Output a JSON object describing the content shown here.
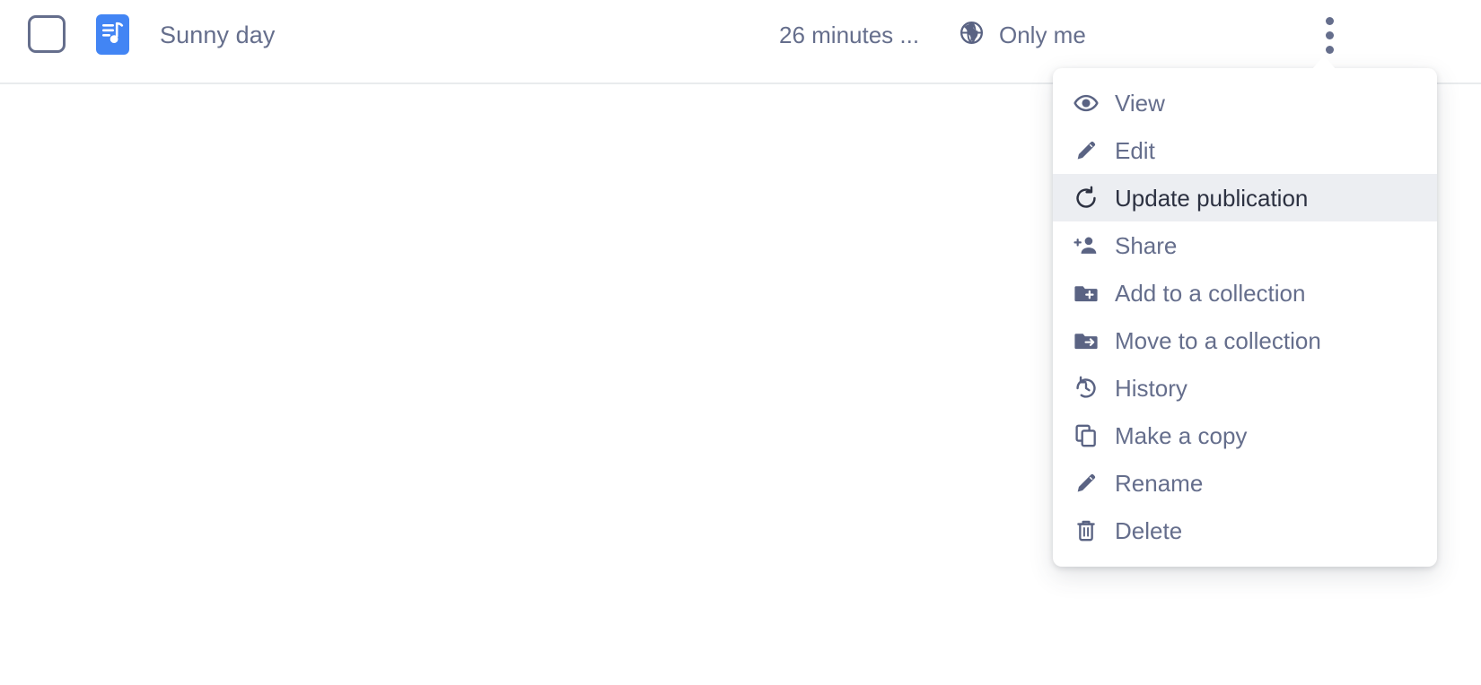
{
  "file_row": {
    "checkbox": {
      "name": "select-file-checkbox",
      "checked": false
    },
    "file_icon_name": "audio-file-icon",
    "title": "Sunny day",
    "modified_time": "26 minutes ...",
    "visibility": {
      "icon_name": "globe-icon",
      "label": "Only me"
    },
    "more_actions": {
      "icon_name": "kebab-menu-icon",
      "label": "More actions"
    }
  },
  "context_menu": {
    "items": [
      {
        "label": "View",
        "icon": "eye-icon",
        "active": false
      },
      {
        "label": "Edit",
        "icon": "pencil-icon",
        "active": false
      },
      {
        "label": "Update publication",
        "icon": "refresh-cw-icon",
        "active": true
      },
      {
        "label": "Share",
        "icon": "person-add-icon",
        "active": false
      },
      {
        "label": "Add to a collection",
        "icon": "folder-plus-icon",
        "active": false
      },
      {
        "label": "Move to a collection",
        "icon": "folder-arrow-icon",
        "active": false
      },
      {
        "label": "History",
        "icon": "history-clock-icon",
        "active": false
      },
      {
        "label": "Make a copy",
        "icon": "copy-icon",
        "active": false
      },
      {
        "label": "Rename",
        "icon": "pencil-icon",
        "active": false
      },
      {
        "label": "Delete",
        "icon": "trash-icon",
        "active": false
      }
    ]
  },
  "colors": {
    "accent_blue": "#4285f4",
    "text_slate": "#656e8c",
    "text_active": "#2c3141",
    "highlight_bg": "#eceef2",
    "divider": "#e9ebed",
    "page_bg": "#ffffff"
  }
}
